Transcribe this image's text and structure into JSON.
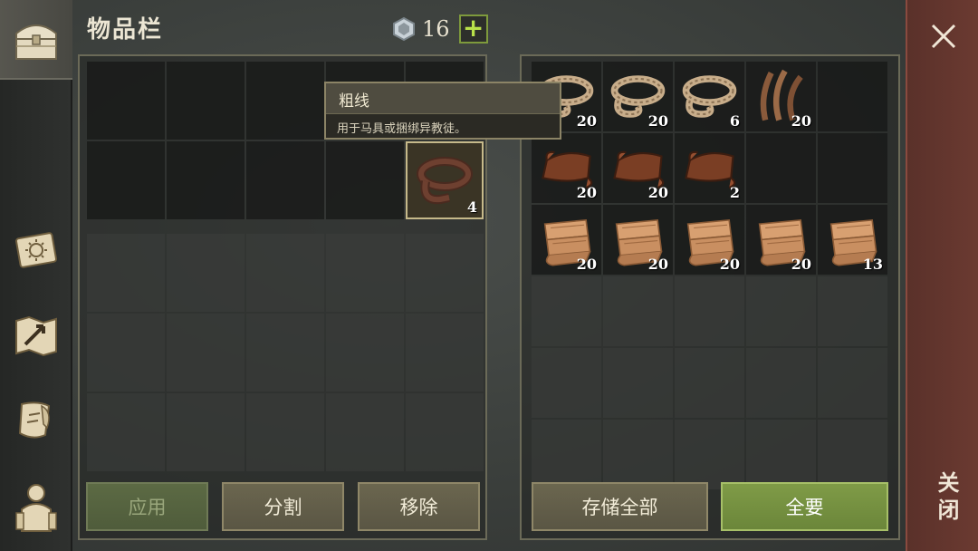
{
  "header": {
    "title": "物品栏",
    "currency_value": "16",
    "currency_icon": "gem-icon",
    "add_label": "+"
  },
  "tooltip": {
    "title": "粗线",
    "description": "用于马具或捆绑异教徒。"
  },
  "left_inventory": {
    "top_slots": [
      {
        "item": "",
        "count": ""
      },
      {
        "item": "",
        "count": ""
      },
      {
        "item": "",
        "count": ""
      },
      {
        "item": "",
        "count": ""
      },
      {
        "item": "",
        "count": ""
      },
      {
        "item": "",
        "count": ""
      },
      {
        "item": "",
        "count": ""
      },
      {
        "item": "",
        "count": ""
      },
      {
        "item": "",
        "count": ""
      },
      {
        "item": "leather-strap",
        "count": "4",
        "selected": true
      }
    ],
    "bottom_slot_count": 15
  },
  "storage": {
    "slots": [
      {
        "item": "rope",
        "count": "20"
      },
      {
        "item": "rope",
        "count": "20"
      },
      {
        "item": "rope",
        "count": "6"
      },
      {
        "item": "plant-fiber",
        "count": "20"
      },
      {
        "item": "",
        "count": ""
      },
      {
        "item": "leather",
        "count": "20"
      },
      {
        "item": "leather",
        "count": "20"
      },
      {
        "item": "leather",
        "count": "2"
      },
      {
        "item": "",
        "count": ""
      },
      {
        "item": "",
        "count": ""
      },
      {
        "item": "cloth",
        "count": "20"
      },
      {
        "item": "cloth",
        "count": "20"
      },
      {
        "item": "cloth",
        "count": "20"
      },
      {
        "item": "cloth",
        "count": "20"
      },
      {
        "item": "cloth",
        "count": "13"
      }
    ],
    "empty_slot_count": 15
  },
  "buttons": {
    "apply": "应用",
    "split": "分割",
    "remove": "移除",
    "store_all": "存储全部",
    "take_all": "全要"
  },
  "close": {
    "label": "关闭"
  },
  "nav": [
    "chest-icon",
    "journal-icon",
    "map-icon",
    "quest-scroll-icon",
    "character-icon"
  ],
  "colors": {
    "accent_green": "#7f9b47",
    "close_red": "#6b3a31",
    "plus_green": "#b9e24a"
  }
}
